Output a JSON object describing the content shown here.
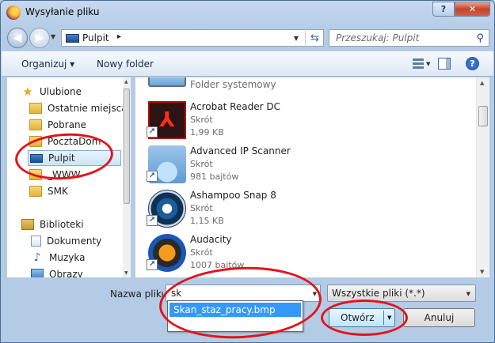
{
  "window": {
    "title": "Wysyłanie pliku",
    "help": "?",
    "close": "✕"
  },
  "address": {
    "location": "Pulpit",
    "separator": "▸",
    "search_placeholder": "Przeszukaj: Pulpit"
  },
  "toolbar": {
    "organize": "Organizuj ▾",
    "new_folder": "Nowy folder",
    "help": "?"
  },
  "nav": {
    "items": [
      {
        "label": "Ulubione"
      },
      {
        "label": "Ostatnie miejsca"
      },
      {
        "label": "Pobrane"
      },
      {
        "label": "PocztaDom"
      },
      {
        "label": "Pulpit"
      },
      {
        "label": "_WWW"
      },
      {
        "label": "SMK"
      },
      {
        "label": "Biblioteki"
      },
      {
        "label": "Dokumenty"
      },
      {
        "label": "Muzyka"
      },
      {
        "label": "Obrazy"
      }
    ]
  },
  "files": [
    {
      "name": "Folder systemowy",
      "type": "",
      "size": ""
    },
    {
      "name": "Acrobat Reader DC",
      "type": "Skrót",
      "size": "1,99 KB"
    },
    {
      "name": "Advanced IP Scanner",
      "type": "Skrót",
      "size": "981 bajtów"
    },
    {
      "name": "Ashampoo Snap 8",
      "type": "Skrót",
      "size": "1,15 KB"
    },
    {
      "name": "Audacity",
      "type": "Skrót",
      "size": "1007 bajtów"
    }
  ],
  "bottom": {
    "filename_label": "Nazwa pliku:",
    "filename_value": "sk",
    "suggestion": "Skan_staz_pracy.bmp",
    "filter": "Wszystkie pliki (*.*)",
    "open": "Otwórz",
    "cancel": "Anuluj"
  },
  "colors": {
    "highlight_marker": "#e3141b",
    "selection": "#3399ff"
  }
}
